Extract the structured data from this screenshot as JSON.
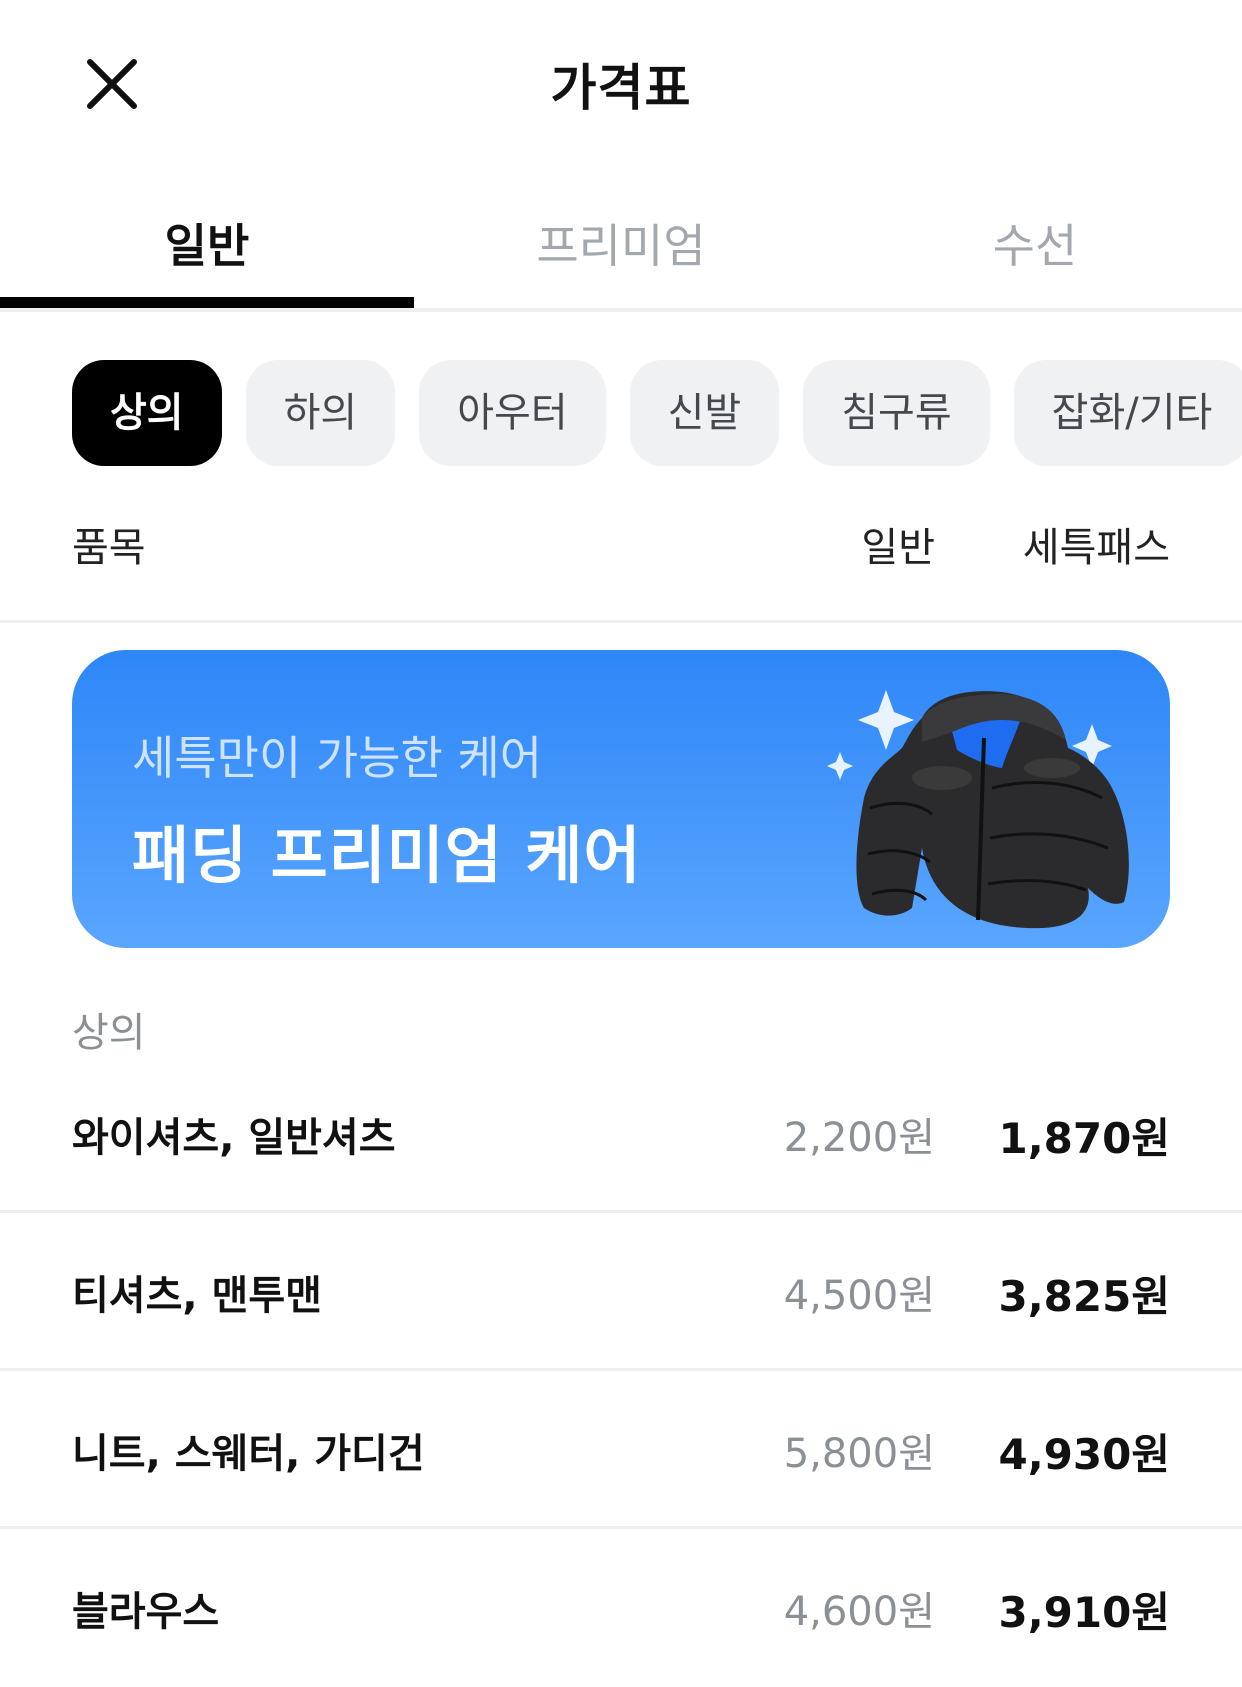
{
  "header": {
    "title": "가격표",
    "close_icon": "close-icon"
  },
  "tabs": [
    {
      "label": "일반",
      "active": true
    },
    {
      "label": "프리미엄",
      "active": false
    },
    {
      "label": "수선",
      "active": false
    }
  ],
  "categories": [
    {
      "label": "상의",
      "active": true
    },
    {
      "label": "하의",
      "active": false
    },
    {
      "label": "아우터",
      "active": false
    },
    {
      "label": "신발",
      "active": false
    },
    {
      "label": "침구류",
      "active": false
    },
    {
      "label": "잡화/기타",
      "active": false
    }
  ],
  "columns": {
    "item": "품목",
    "normal": "일반",
    "set": "세특패스"
  },
  "banner": {
    "subtitle": "세특만이 가능한 케어",
    "title": "패딩 프리미엄 케어",
    "image": "puffer-jacket-image",
    "colors": {
      "top": "#2e86f7",
      "bottom": "#5aa6ff"
    }
  },
  "section": {
    "label": "상의"
  },
  "items": [
    {
      "name": "와이셔츠, 일반셔츠",
      "normal_price": "2,200원",
      "set_price": "1,870원"
    },
    {
      "name": "티셔츠, 맨투맨",
      "normal_price": "4,500원",
      "set_price": "3,825원"
    },
    {
      "name": "니트, 스웨터, 가디건",
      "normal_price": "5,800원",
      "set_price": "4,930원"
    },
    {
      "name": "블라우스",
      "normal_price": "4,600원",
      "set_price": "3,910원"
    }
  ]
}
